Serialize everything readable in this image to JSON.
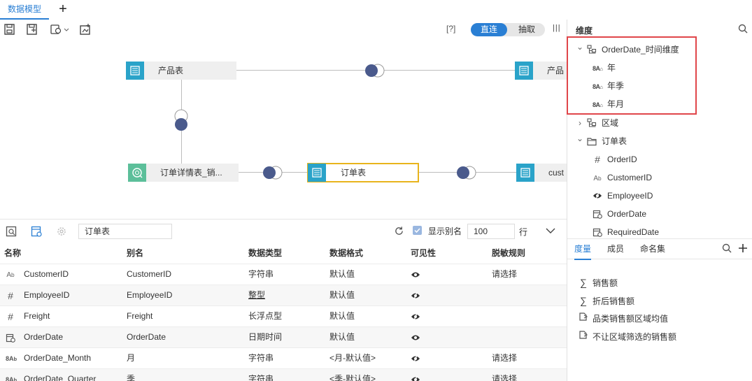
{
  "tabs": {
    "active": "数据模型",
    "add": "+"
  },
  "toolbar": {
    "icons": [
      "save-icon",
      "save-as-icon",
      "data-source-settings-icon",
      "refresh-model-icon"
    ],
    "help": "[?]",
    "mode_live": "直连",
    "mode_extract": "抽取",
    "panel_toggle": "|||"
  },
  "canvas": {
    "nodes": [
      {
        "label": "产品表",
        "type": "table"
      },
      {
        "label": "产品",
        "type": "table"
      },
      {
        "label": "订单详情表_销...",
        "type": "query"
      },
      {
        "label": "订单表",
        "type": "table",
        "selected": true
      },
      {
        "label": "cust",
        "type": "table"
      }
    ]
  },
  "right": {
    "dim_title": "维度",
    "tree": [
      {
        "label": "OrderDate_时间维度",
        "icon": "hierarchy-icon",
        "expanded": true,
        "level": 0
      },
      {
        "label": "年",
        "icon": "date-level-icon",
        "level": 1
      },
      {
        "label": "年季",
        "icon": "date-level-icon",
        "level": 1
      },
      {
        "label": "年月",
        "icon": "date-level-icon",
        "level": 1
      },
      {
        "label": "区域",
        "icon": "hierarchy-icon",
        "expanded": false,
        "level": 0
      },
      {
        "label": "订单表",
        "icon": "folder-icon",
        "expanded": true,
        "level": 0
      },
      {
        "label": "OrderID",
        "icon": "number-icon",
        "level": 1
      },
      {
        "label": "CustomerID",
        "icon": "text-icon",
        "level": 1
      },
      {
        "label": "EmployeeID",
        "icon": "hidden-icon",
        "level": 1
      },
      {
        "label": "OrderDate",
        "icon": "date-icon",
        "level": 1
      },
      {
        "label": "RequiredDate",
        "icon": "date-icon",
        "level": 1
      }
    ],
    "measure_tabs": [
      "度量",
      "成员",
      "命名集"
    ],
    "measures": [
      {
        "label": "销售额",
        "icon": "sum-icon"
      },
      {
        "label": "折后销售额",
        "icon": "sum-icon"
      },
      {
        "label": "品类销售额区域均值",
        "icon": "calc-measure-icon"
      },
      {
        "label": "不让区域筛选的销售额",
        "icon": "calc-measure-icon"
      }
    ]
  },
  "bottom": {
    "table_name": "订单表",
    "show_alias_label": "显示别名",
    "rows_value": "100",
    "rows_unit": "行",
    "columns": [
      "名称",
      "别名",
      "数据类型",
      "数据格式",
      "可见性",
      "脱敏规则"
    ],
    "rows": [
      {
        "icon": "text-icon",
        "name": "CustomerID",
        "alias": "CustomerID",
        "type": "字符串",
        "format": "默认值",
        "visible": "visible-icon",
        "mask": "请选择",
        "type_link": false
      },
      {
        "icon": "number-icon",
        "name": "EmployeeID",
        "alias": "EmployeeID",
        "type": "整型",
        "format": "默认值",
        "visible": "hidden-icon",
        "mask": "",
        "type_link": true
      },
      {
        "icon": "number-icon",
        "name": "Freight",
        "alias": "Freight",
        "type": "长浮点型",
        "format": "默认值",
        "visible": "hidden-icon",
        "mask": "",
        "type_link": false
      },
      {
        "icon": "date-icon",
        "name": "OrderDate",
        "alias": "OrderDate",
        "type": "日期时间",
        "format": "默认值",
        "visible": "visible-icon",
        "mask": "",
        "type_link": false
      },
      {
        "icon": "date-text-icon",
        "name": "OrderDate_Month",
        "alias": "月",
        "type": "字符串",
        "format": "<月-默认值>",
        "visible": "hidden-icon",
        "mask": "请选择",
        "type_link": false
      },
      {
        "icon": "date-text-icon",
        "name": "OrderDate_Quarter",
        "alias": "季",
        "type": "字符串",
        "format": "<季-默认值>",
        "visible": "hidden-icon",
        "mask": "请选择",
        "type_link": false
      }
    ]
  },
  "colors": {
    "accent": "#2a7fd4",
    "table_node": "#2aa3c9",
    "query_node": "#5cbf9a",
    "joint": "#4a5a8c",
    "selected": "#e8b41c",
    "highlight": "#e0464a"
  }
}
